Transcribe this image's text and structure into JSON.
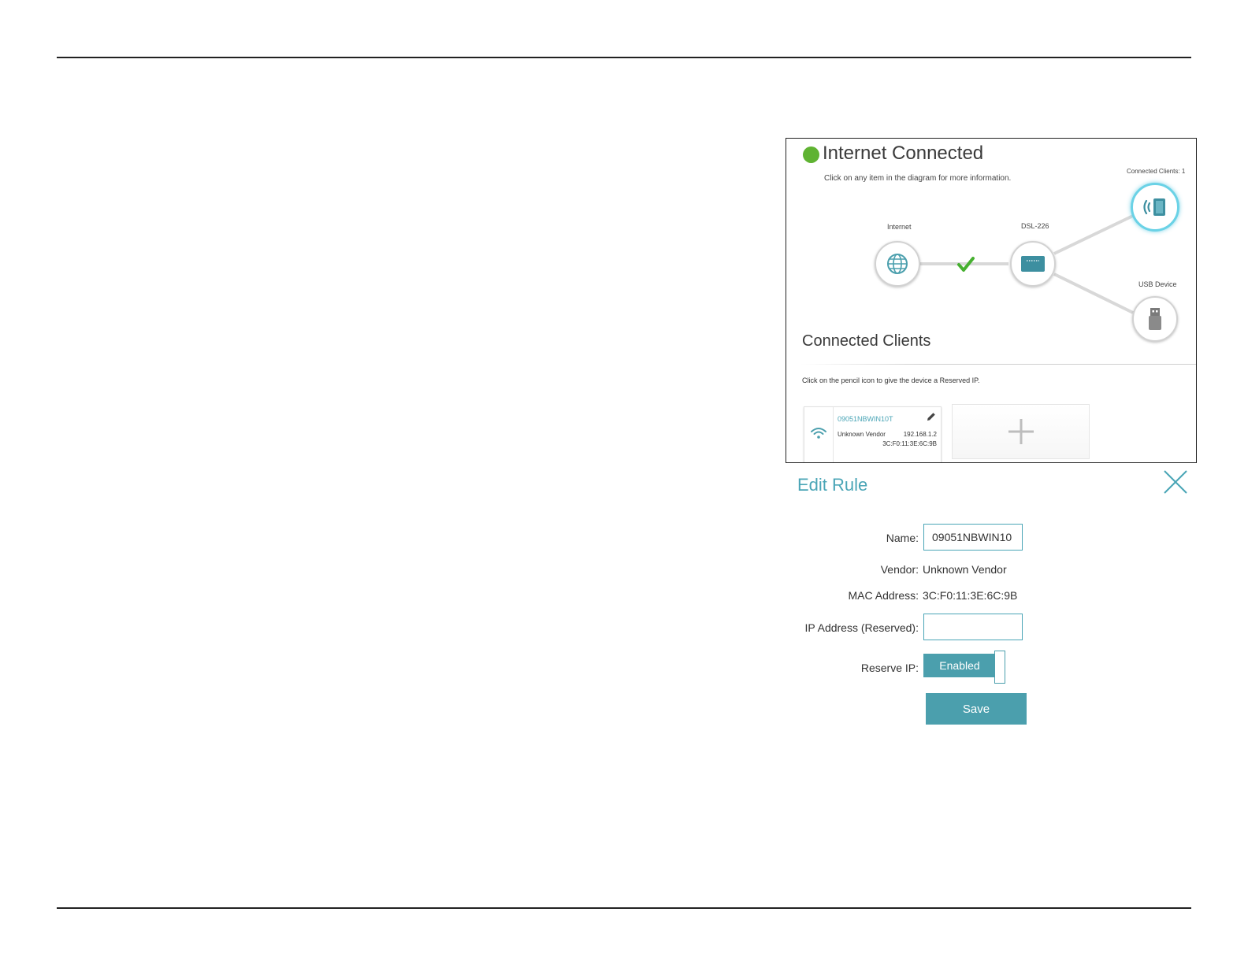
{
  "status": {
    "title": "Internet Connected",
    "hint": "Click on any item in the diagram for more information.",
    "connected_clients": "Connected Clients: 1",
    "dot_color": "#5fb332"
  },
  "diagram": {
    "internet_label": "Internet",
    "router_label": "DSL-226",
    "usb_label": "USB Device"
  },
  "clients": {
    "title": "Connected Clients",
    "hint": "Click on the pencil icon to give the device a Reserved IP.",
    "items": [
      {
        "name": "09051NBWIN10T",
        "vendor": "Unknown Vendor",
        "ip": "192.168.1.2",
        "mac": "3C:F0:11:3E:6C:9B"
      }
    ]
  },
  "edit_rule": {
    "title": "Edit Rule",
    "name_label": "Name:",
    "name_value": "09051NBWIN10",
    "vendor_label": "Vendor:",
    "vendor_value": "Unknown Vendor",
    "mac_label": "MAC Address:",
    "mac_value": "3C:F0:11:3E:6C:9B",
    "ip_label": "IP Address (Reserved):",
    "ip_value": "",
    "reserve_label": "Reserve IP:",
    "reserve_state": "Enabled",
    "save_label": "Save"
  },
  "colors": {
    "accent": "#4aa5b6",
    "button": "#4b9fad",
    "active_ring": "#6ad2e6"
  }
}
